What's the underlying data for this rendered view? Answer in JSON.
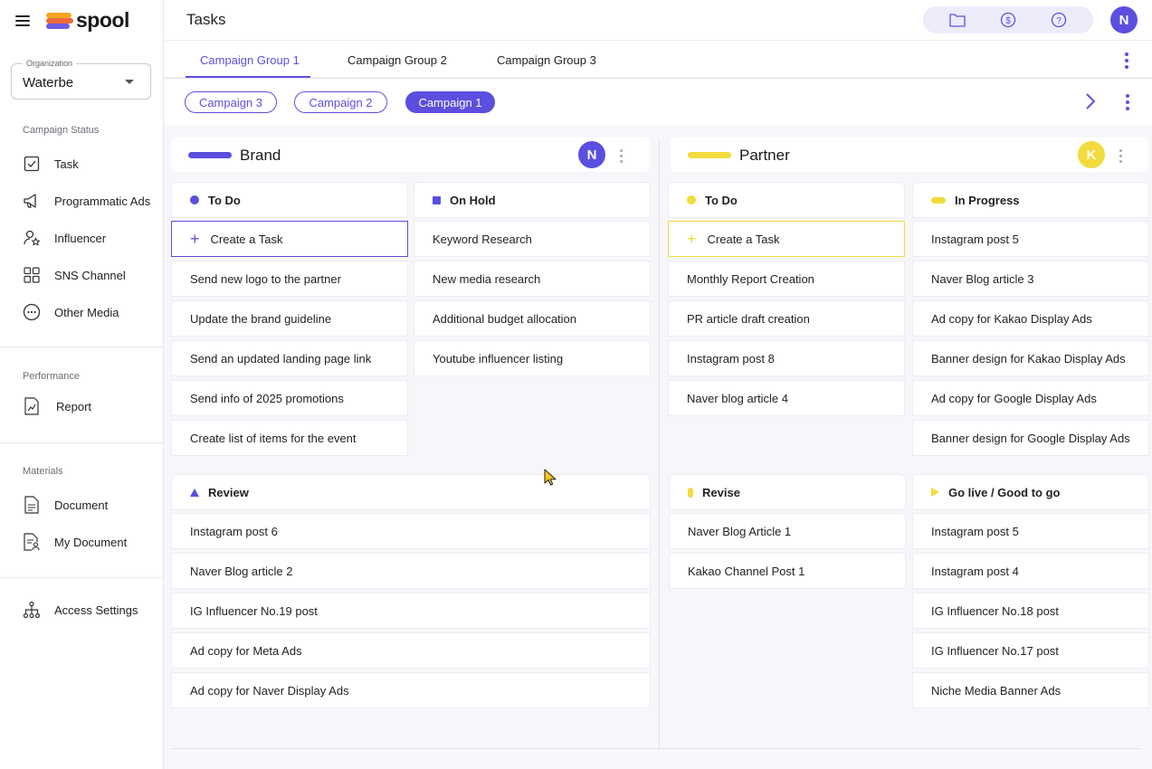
{
  "app": {
    "name": "spool"
  },
  "sidebar": {
    "org_label": "Organization",
    "org_value": "Waterbe",
    "sections": [
      {
        "title": "Campaign Status",
        "items": [
          {
            "label": "Task",
            "icon": "checkbox-icon"
          },
          {
            "label": "Programmatic Ads",
            "icon": "megaphone-icon"
          },
          {
            "label": "Influencer",
            "icon": "influencer-icon"
          },
          {
            "label": "SNS Channel",
            "icon": "grid-icon"
          },
          {
            "label": "Other Media",
            "icon": "more-circle-icon"
          }
        ]
      },
      {
        "title": "Performance",
        "items": [
          {
            "label": "Report",
            "icon": "report-icon"
          }
        ]
      },
      {
        "title": "Materials",
        "items": [
          {
            "label": "Document",
            "icon": "document-icon"
          },
          {
            "label": "My Document",
            "icon": "my-document-icon"
          }
        ]
      },
      {
        "title": "",
        "items": [
          {
            "label": "Access Settings",
            "icon": "hierarchy-icon"
          }
        ]
      }
    ]
  },
  "header": {
    "title": "Tasks",
    "icons": [
      "folder-icon",
      "dollar-icon",
      "help-icon"
    ],
    "avatar_letter": "N"
  },
  "tabs": [
    "Campaign Group 1",
    "Campaign Group 2",
    "Campaign Group 3"
  ],
  "active_tab": 0,
  "chips": [
    "Campaign 3",
    "Campaign 2",
    "Campaign 1"
  ],
  "selected_chip": 2,
  "colors": {
    "accent": "#5b4fe0",
    "partner": "#f2db3c"
  },
  "brand": {
    "title": "Brand",
    "avatar_letter": "N",
    "columns": {
      "todo": {
        "title": "To Do",
        "create_label": "Create a Task",
        "items": [
          "Send new logo to the partner",
          "Update the brand guideline",
          "Send an updated landing page link",
          "Send info of 2025 promotions",
          "Create list of items for the event"
        ]
      },
      "onhold": {
        "title": "On Hold",
        "items": [
          "Keyword Research",
          "New media research",
          "Additional budget allocation",
          "Youtube influencer listing"
        ]
      },
      "review": {
        "title": "Review",
        "items": [
          "Instagram post 6",
          "Naver Blog article 2",
          "IG Influencer No.19 post",
          "Ad copy for Meta Ads",
          "Ad copy for Naver Display Ads"
        ]
      }
    }
  },
  "partner": {
    "title": "Partner",
    "avatar_letter": "K",
    "columns": {
      "todo": {
        "title": "To Do",
        "create_label": "Create a Task",
        "items": [
          "Monthly Report Creation",
          "PR article draft creation",
          "Instagram post 8",
          "Naver blog article 4"
        ]
      },
      "inprogress": {
        "title": "In Progress",
        "items": [
          "Instagram post 5",
          "Naver Blog article 3",
          "Ad copy for Kakao Display Ads",
          "Banner design for Kakao Display Ads",
          "Ad copy for Google Display Ads",
          "Banner design for Google Display Ads"
        ]
      },
      "revise": {
        "title": "Revise",
        "items": [
          "Naver Blog Article 1",
          "Kakao Channel Post 1"
        ]
      },
      "golive": {
        "title": "Go live / Good to go",
        "items": [
          "Instagram post 5",
          "Instagram post 4",
          "IG Influencer No.18 post",
          "IG Influencer No.17 post",
          "Niche Media Banner Ads"
        ]
      }
    }
  }
}
